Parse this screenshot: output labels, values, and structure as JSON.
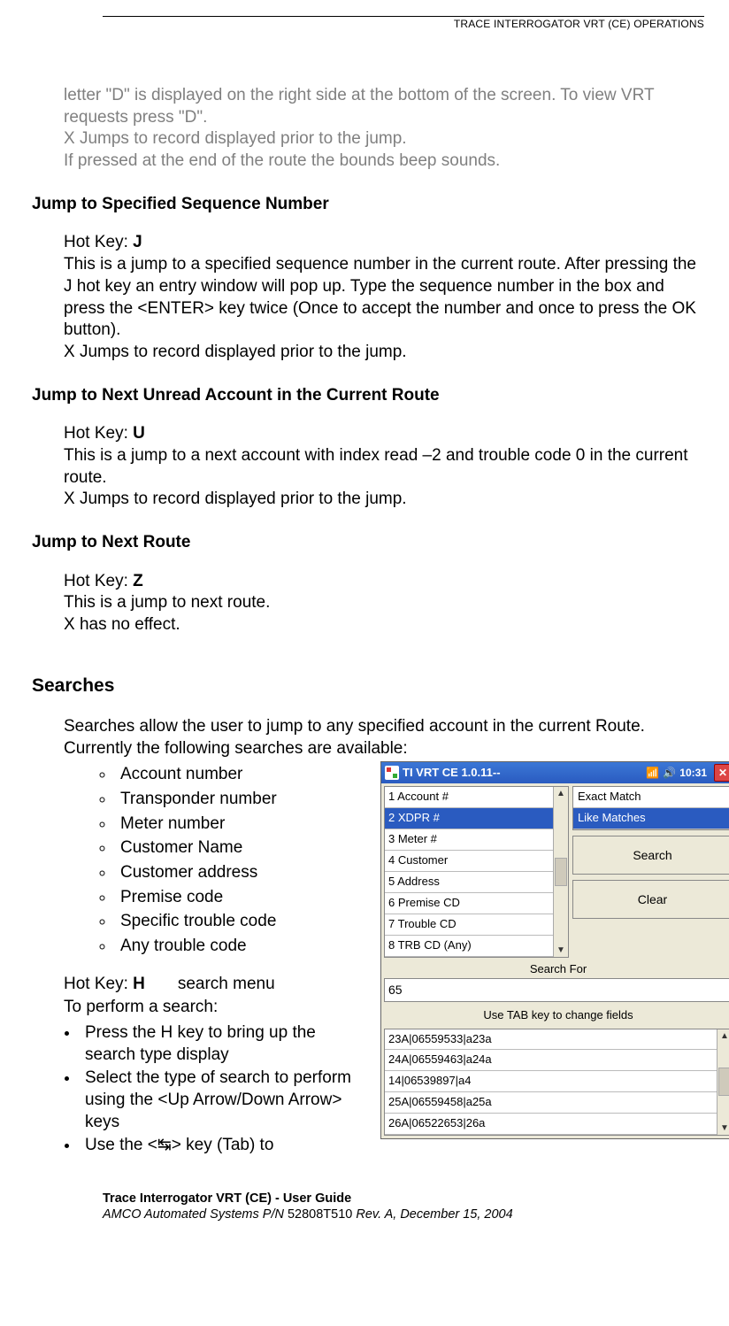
{
  "header": "TRACE INTERROGATOR VRT (CE) OPERATIONS",
  "intro_gray": [
    "letter \"D\" is displayed on the right side at the bottom of the screen. To view VRT requests press \"D\".",
    "X Jumps to record displayed prior to the jump.",
    "If pressed at the end of the route the bounds beep sounds."
  ],
  "sec1": {
    "title": "Jump to Specified Sequence Number",
    "hotkey_label": "Hot Key: ",
    "hotkey": "J",
    "body": [
      "This is a jump to a specified sequence number in the current route. After pressing the J hot key an entry window will pop up. Type the sequence number in the box and press the <ENTER> key twice (Once to accept the number and once to press the OK button).",
      "X Jumps to record displayed prior to the jump."
    ]
  },
  "sec2": {
    "title": "Jump to Next Unread Account in the Current Route",
    "hotkey_label": "Hot Key: ",
    "hotkey": "U",
    "body": [
      "This is a jump to a next account with index read –2 and trouble code 0 in the current route.",
      "X Jumps to record displayed prior to the jump."
    ]
  },
  "sec3": {
    "title": "Jump to Next Route",
    "hotkey_label": "Hot Key: ",
    "hotkey": "Z",
    "body": [
      "This is a jump to next route.",
      "X has no effect."
    ]
  },
  "searches": {
    "heading": "Searches",
    "intro": "Searches allow the user to jump to any specified account in the current Route. Currently the following searches are available:",
    "list": [
      "Account number",
      "Transponder number",
      "Meter number",
      "Customer Name",
      "Customer address",
      "Premise code",
      "Specific trouble code",
      "Any trouble code"
    ],
    "hotkey_line_pre": "Hot Key: ",
    "hotkey": "H",
    "hotkey_line_post": "search menu",
    "perform_label": "To perform a search:",
    "steps": [
      "Press the H key to bring up the search type display",
      "Select the type of search to perform using the <Up Arrow/Down Arrow> keys",
      "Use the <↹> key (Tab) to"
    ]
  },
  "screenshot": {
    "title": "TI VRT CE 1.0.11--",
    "clock": "10:31",
    "list_items": [
      "1 Account #",
      "2 XDPR #",
      "3 Meter #",
      "4 Customer",
      "5 Address",
      "6 Premise CD",
      "7 Trouble  CD",
      "8 TRB CD (Any)"
    ],
    "list_selected_index": 1,
    "match_options": [
      "Exact Match",
      "Like Matches"
    ],
    "match_selected_index": 1,
    "search_btn": "Search",
    "clear_btn": "Clear",
    "search_for_label": "Search For",
    "input_value": "65",
    "hint": "Use TAB key to change fields",
    "results": [
      "23A|06559533|a23a",
      "24A|06559463|a24a",
      "14|06539897|a4",
      "25A|06559458|a25a",
      "26A|06522653|26a"
    ]
  },
  "footer": {
    "line1": "Trace Interrogator VRT (CE) - User Guide",
    "line2_pre": "AMCO Automated Systems P/N ",
    "pn": "52808T510",
    "line2_post": " Rev. A, December 15, 2004"
  }
}
